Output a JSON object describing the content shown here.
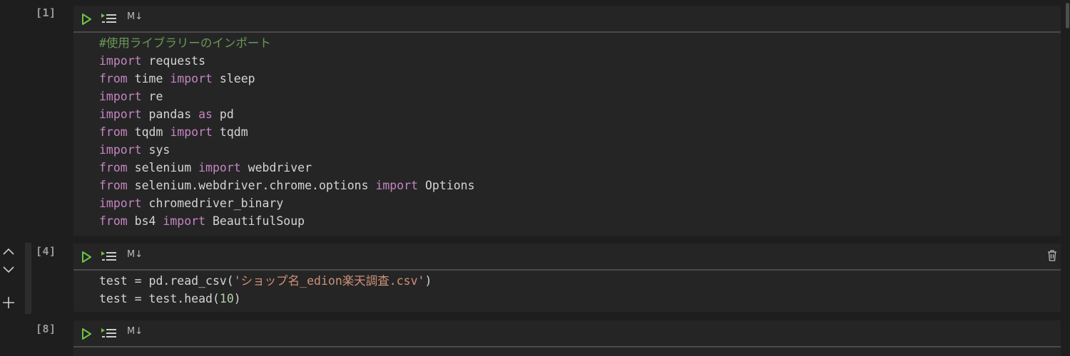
{
  "cells": [
    {
      "count": "[1]",
      "md_label": "M↓",
      "lines": [
        [
          {
            "t": "#使用ライブラリーのインポート",
            "c": "cm"
          }
        ],
        [
          {
            "t": "import",
            "c": "kw"
          },
          {
            "t": " requests"
          }
        ],
        [
          {
            "t": "from",
            "c": "kw"
          },
          {
            "t": " time "
          },
          {
            "t": "import",
            "c": "kw"
          },
          {
            "t": " sleep"
          }
        ],
        [
          {
            "t": "import",
            "c": "kw"
          },
          {
            "t": " re"
          }
        ],
        [
          {
            "t": "import",
            "c": "kw"
          },
          {
            "t": " pandas "
          },
          {
            "t": "as",
            "c": "kw"
          },
          {
            "t": " pd"
          }
        ],
        [
          {
            "t": "from",
            "c": "kw"
          },
          {
            "t": " tqdm "
          },
          {
            "t": "import",
            "c": "kw"
          },
          {
            "t": " tqdm"
          }
        ],
        [
          {
            "t": "import",
            "c": "kw"
          },
          {
            "t": " sys"
          }
        ],
        [
          {
            "t": "from",
            "c": "kw"
          },
          {
            "t": " selenium "
          },
          {
            "t": "import",
            "c": "kw"
          },
          {
            "t": " webdriver"
          }
        ],
        [
          {
            "t": "from",
            "c": "kw"
          },
          {
            "t": " selenium.webdriver.chrome.options "
          },
          {
            "t": "import",
            "c": "kw"
          },
          {
            "t": " Options"
          }
        ],
        [
          {
            "t": "import",
            "c": "kw"
          },
          {
            "t": " chromedriver_binary"
          }
        ],
        [
          {
            "t": "from",
            "c": "kw"
          },
          {
            "t": " bs4 "
          },
          {
            "t": "import",
            "c": "kw"
          },
          {
            "t": " BeautifulSoup"
          }
        ]
      ]
    },
    {
      "count": "[4]",
      "md_label": "M↓",
      "lines": [
        [
          {
            "t": "test = pd.read_csv("
          },
          {
            "t": "'ショップ名_edion楽天調査.csv'",
            "c": "str"
          },
          {
            "t": ")"
          }
        ],
        [
          {
            "t": "test = test.head("
          },
          {
            "t": "10",
            "c": "num"
          },
          {
            "t": ")"
          }
        ]
      ]
    },
    {
      "count": "[8]",
      "md_label": "M↓",
      "lines": []
    }
  ],
  "icons": {
    "run": "play-icon",
    "run_below": "run-below-icon",
    "delete": "trash-icon",
    "move_up": "chevron-up-icon",
    "move_down": "chevron-down-icon",
    "add": "plus-icon"
  },
  "colors": {
    "background": "#1e1e1e",
    "cell_bg": "#252526",
    "keyword": "#c586c0",
    "comment": "#6a9955",
    "string": "#ce9178",
    "number": "#b5cea8",
    "run_green": "#6cc644"
  }
}
